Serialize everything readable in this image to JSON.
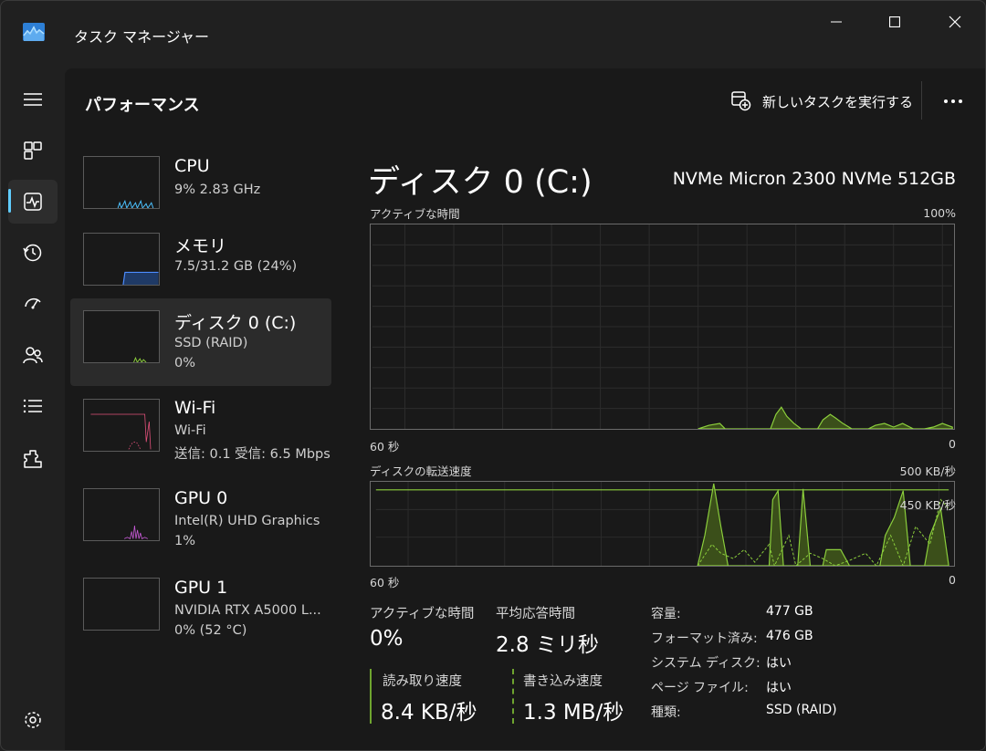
{
  "window": {
    "title": "タスク マネージャー"
  },
  "header": {
    "page_title": "パフォーマンス",
    "new_task_label": "新しいタスクを実行する"
  },
  "nav": {
    "items": [
      {
        "name": "hamburger-menu-icon"
      },
      {
        "name": "processes-icon"
      },
      {
        "name": "performance-icon"
      },
      {
        "name": "app-history-icon"
      },
      {
        "name": "startup-apps-icon"
      },
      {
        "name": "users-icon"
      },
      {
        "name": "details-icon"
      },
      {
        "name": "services-icon"
      },
      {
        "name": "settings-icon"
      }
    ],
    "active": "performance-icon"
  },
  "resources": [
    {
      "name": "CPU",
      "sub1": "9% 2.83 GHz",
      "sub2": "",
      "color": "#4cc2ff"
    },
    {
      "name": "メモリ",
      "sub1": "7.5/31.2 GB (24%)",
      "sub2": "",
      "color": "#4c8cff"
    },
    {
      "name": "ディスク 0 (C:)",
      "sub1": "SSD (RAID)",
      "sub2": "0%",
      "color": "#8ccf3c"
    },
    {
      "name": "Wi-Fi",
      "sub1": "Wi-Fi",
      "sub2": "送信: 0.1  受信: 6.5 Mbps",
      "color": "#e0507a"
    },
    {
      "name": "GPU 0",
      "sub1": "Intel(R) UHD Graphics",
      "sub2": "1%",
      "color": "#c85ad8"
    },
    {
      "name": "GPU 1",
      "sub1": "NVIDIA RTX A5000 L...",
      "sub2": "0% (52 °C)",
      "color": "#c85ad8"
    }
  ],
  "detail": {
    "title": "ディスク 0 (C:)",
    "model": "NVMe Micron 2300 NVMe 512GB",
    "active_chart": {
      "label": "アクティブな時間",
      "max_label": "100%",
      "x_left": "60 秒",
      "x_right": "0"
    },
    "transfer_chart": {
      "label": "ディスクの転送速度",
      "max_label": "500 KB/秒",
      "mid_label": "450 KB/秒",
      "x_left": "60 秒",
      "x_right": "0"
    },
    "stats": {
      "active_time_label": "アクティブな時間",
      "active_time_value": "0%",
      "avg_response_label": "平均応答時間",
      "avg_response_value": "2.8 ミリ秒",
      "read_label": "読み取り速度",
      "read_value": "8.4 KB/秒",
      "write_label": "書き込み速度",
      "write_value": "1.3 MB/秒"
    },
    "info": [
      {
        "key": "容量:",
        "value": "477 GB"
      },
      {
        "key": "フォーマット済み:",
        "value": "476 GB"
      },
      {
        "key": "システム ディスク:",
        "value": "はい"
      },
      {
        "key": "ページ ファイル:",
        "value": "はい"
      },
      {
        "key": "種類:",
        "value": "SSD (RAID)"
      }
    ]
  },
  "colors": {
    "accent": "#60cdff",
    "disk_green": "#8ccf3c"
  }
}
